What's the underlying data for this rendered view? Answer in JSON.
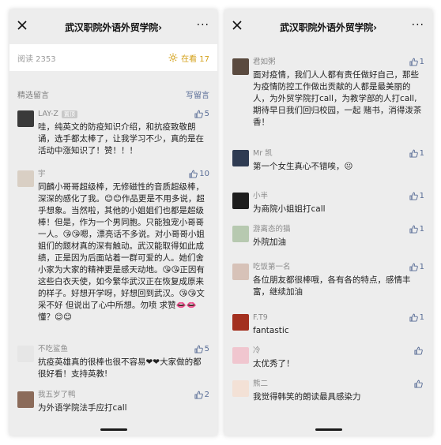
{
  "left": {
    "header": {
      "title": "武汉职院外语外贸学院",
      "chevron": "›",
      "more": "···"
    },
    "read": {
      "label": "阅读 2353",
      "wow_label": "在看 17"
    },
    "section": {
      "title": "精选留言",
      "write": "写留言"
    },
    "comments": [
      {
        "name": "LAY-Z",
        "badge": "置顶",
        "likes": "5",
        "avatar": "#3a3a3a",
        "text": "哇，纯英文的防疫知识介绍，和抗疫致敬朗诵，选手都太棒了，让我学习不少，真的是在活动中涨知识了！赞！！！"
      },
      {
        "name": "宇",
        "badge": "",
        "likes": "10",
        "avatar": "#d9cfc4",
        "text": "同麟小哥哥超级棒，无修磁性的音质超级棒，深深的感化了我。😊😊作品更是不用多说，超乎想象。当然啦，其他的小姐姐们也都是超级棒！但是，作为一个男同胞。只能独宠小哥哥一人。😘😘嗯，漂亮话不多说。对小哥哥小姐姐们的题材真的深有触动。武汉能取得如此成绩，正是因为后面站着一群可爱的人。她们舍小家为大家的精神更是感天动地。😘😘正因有这些白衣天使，如今繁华武汉正在恢复成原来的样子。好想开学呀，好想回到武汉。😘😘文采不好 但说出了心中所想。勿喷 求赞👄👄懂？😊😊"
      },
      {
        "name": "不吃鲨鱼",
        "badge": "",
        "likes": "5",
        "avatar": "#e6e6e6",
        "text": "抗疫英雄真的很棒也很不容易❤❤大家做的都很好看！支持英教!"
      },
      {
        "name": "我五岁了鸭",
        "badge": "",
        "likes": "2",
        "avatar": "#8b6b5a",
        "text": "为外语学院法手应打call"
      }
    ]
  },
  "right": {
    "header": {
      "title": "武汉职院外语外贸学院",
      "chevron": "›",
      "more": "···"
    },
    "comments": [
      {
        "name": "君如粥",
        "likes": "1",
        "avatar": "#5a4a3f",
        "text": "面对疫情，我们人人都有责任做好自己，那些为疫情防控工作做出贡献的人都是最美丽的人，为外贸学院打call，为教学部的人打call,期待早日我们回归校园，一起 赌书，消得泼茶香！"
      },
      {
        "name": "Mr 凯",
        "likes": "1",
        "avatar": "#2f3b52",
        "text": "第一个女生真心不错唉，😐"
      },
      {
        "name": "小半",
        "likes": "1",
        "avatar": "#1e1e1e",
        "text": "为商院小姐姐打call"
      },
      {
        "name": "游离态的猫",
        "likes": "1",
        "avatar": "#b7c9b0",
        "text": "外院加油"
      },
      {
        "name": "吃饭第一名",
        "likes": "1",
        "avatar": "#d7c2b8",
        "text": "各位朋友都很棒哦，各有各的特点，感情丰富，继续加油"
      },
      {
        "name": "F.T9",
        "likes": "1",
        "avatar": "#a3301f",
        "text": "fantastic"
      },
      {
        "name": "冷",
        "likes": "",
        "avatar": "#f0c6cf",
        "text": "太优秀了！"
      },
      {
        "name": "熊二",
        "likes": "",
        "avatar": "#f3e1d6",
        "text": "我觉得韩笑的朗读最具感染力"
      }
    ]
  },
  "colors": {
    "link": "#576b95",
    "wow": "#d4a21b",
    "bg": "#ededed"
  },
  "icons": {
    "close": "close-icon",
    "more": "more-icon",
    "like": "thumb-up-icon",
    "wow": "wow-sparkle-icon"
  }
}
